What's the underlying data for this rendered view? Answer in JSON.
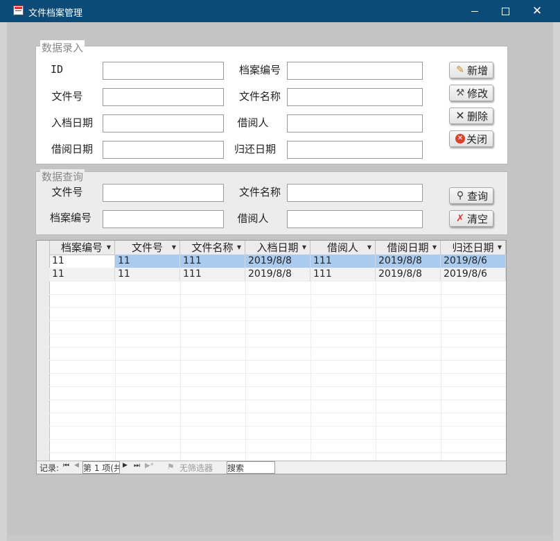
{
  "window": {
    "title": "文件档案管理",
    "icons": {
      "app": "form-icon",
      "minimize": "minimize-icon",
      "maximize": "maximize-icon",
      "close": "close-icon"
    }
  },
  "entry": {
    "legend": "数据录入",
    "labels": {
      "id": "ID",
      "archive_no": "档案编号",
      "file_no": "文件号",
      "file_name": "文件名称",
      "archive_date": "入档日期",
      "borrower": "借阅人",
      "borrow_date": "借阅日期",
      "return_date": "归还日期"
    },
    "values": {
      "id": "",
      "archive_no": "",
      "file_no": "",
      "file_name": "",
      "archive_date": "",
      "borrower": "",
      "borrow_date": "",
      "return_date": ""
    },
    "buttons": {
      "add": "新增",
      "edit": "修改",
      "delete": "删除",
      "close": "关闭"
    }
  },
  "query": {
    "legend": "数据查询",
    "labels": {
      "file_no": "文件号",
      "file_name": "文件名称",
      "archive_no": "档案编号",
      "borrower": "借阅人"
    },
    "values": {
      "file_no": "",
      "file_name": "",
      "archive_no": "",
      "borrower": ""
    },
    "buttons": {
      "search": "查询",
      "clear": "清空"
    }
  },
  "table": {
    "columns": [
      "档案编号",
      "文件号",
      "文件名称",
      "入档日期",
      "借阅人",
      "借阅日期",
      "归还日期"
    ],
    "rows": [
      [
        "11",
        "11",
        "111",
        "2019/8/8",
        "111",
        "2019/8/8",
        "2019/8/6"
      ],
      [
        "11",
        "11",
        "111",
        "2019/8/8",
        "111",
        "2019/8/8",
        "2019/8/6"
      ]
    ],
    "selected_row_color": "#aacbee"
  },
  "navigator": {
    "record_label": "记录:",
    "position": "第 1 项(共",
    "filter": "无筛选器",
    "search": "搜索"
  }
}
